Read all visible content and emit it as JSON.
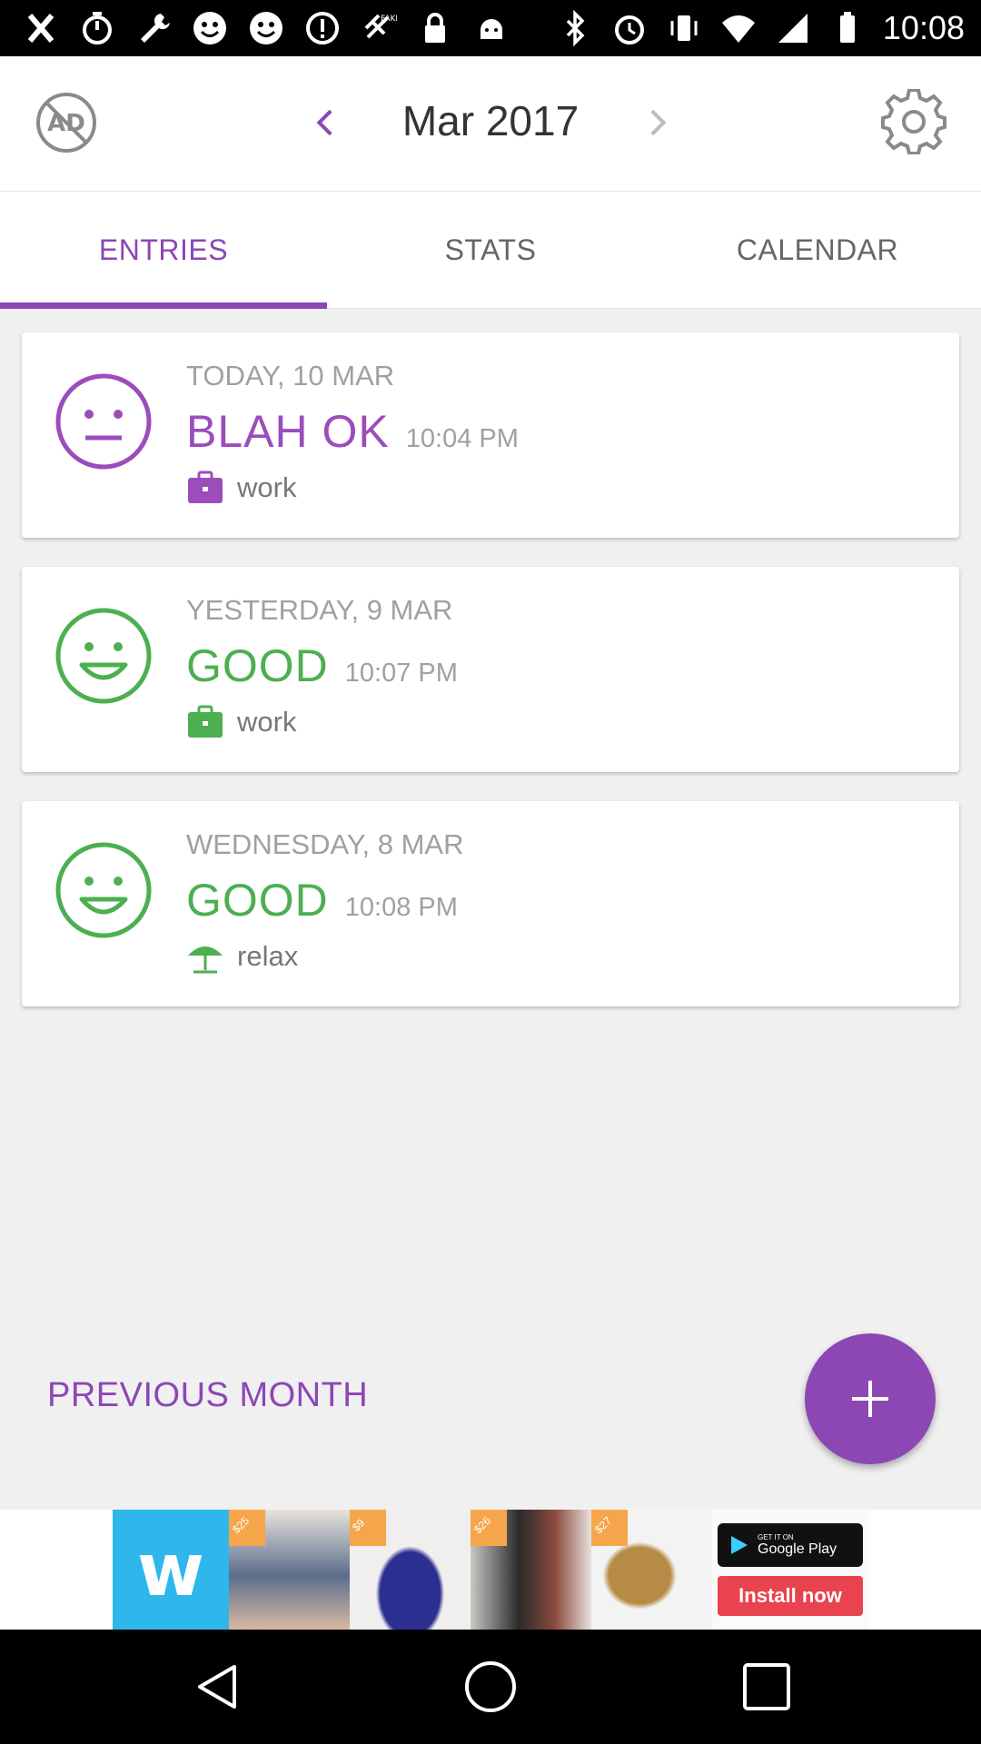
{
  "status_bar": {
    "time": "10:08",
    "left_icons": [
      "x-icon",
      "timer-icon",
      "wrench-icon",
      "smiley-icon",
      "smiley-icon",
      "alert-icon",
      "fake-gps-icon",
      "lock-icon",
      "android-icon"
    ],
    "right_icons": [
      "bluetooth-icon",
      "alarm-icon",
      "vibrate-icon",
      "wifi-icon",
      "signal-icon",
      "battery-icon"
    ]
  },
  "header": {
    "month": "Mar 2017"
  },
  "tabs": [
    {
      "label": "ENTRIES",
      "active": true
    },
    {
      "label": "STATS",
      "active": false
    },
    {
      "label": "CALENDAR",
      "active": false
    }
  ],
  "entries": [
    {
      "date": "TODAY, 10 MAR",
      "mood": "BLAH OK",
      "time": "10:04 PM",
      "activity": "work",
      "activity_icon": "briefcase-icon",
      "color": "#9c4cbb"
    },
    {
      "date": "YESTERDAY, 9 MAR",
      "mood": "GOOD",
      "time": "10:07 PM",
      "activity": "work",
      "activity_icon": "briefcase-icon",
      "color": "#4caf50"
    },
    {
      "date": "WEDNESDAY, 8 MAR",
      "mood": "GOOD",
      "time": "10:08 PM",
      "activity": "relax",
      "activity_icon": "umbrella-icon",
      "color": "#4caf50"
    }
  ],
  "footer": {
    "previous_month": "PREVIOUS MONTH"
  },
  "ad": {
    "logo": "w",
    "prices": [
      "$25",
      "$9",
      "$26",
      "$27"
    ],
    "store_small": "GET IT ON",
    "store_big": "Google Play",
    "install": "Install now"
  },
  "colors": {
    "accent": "#8c47b5",
    "good": "#4caf50",
    "blah": "#9c4cbb"
  }
}
